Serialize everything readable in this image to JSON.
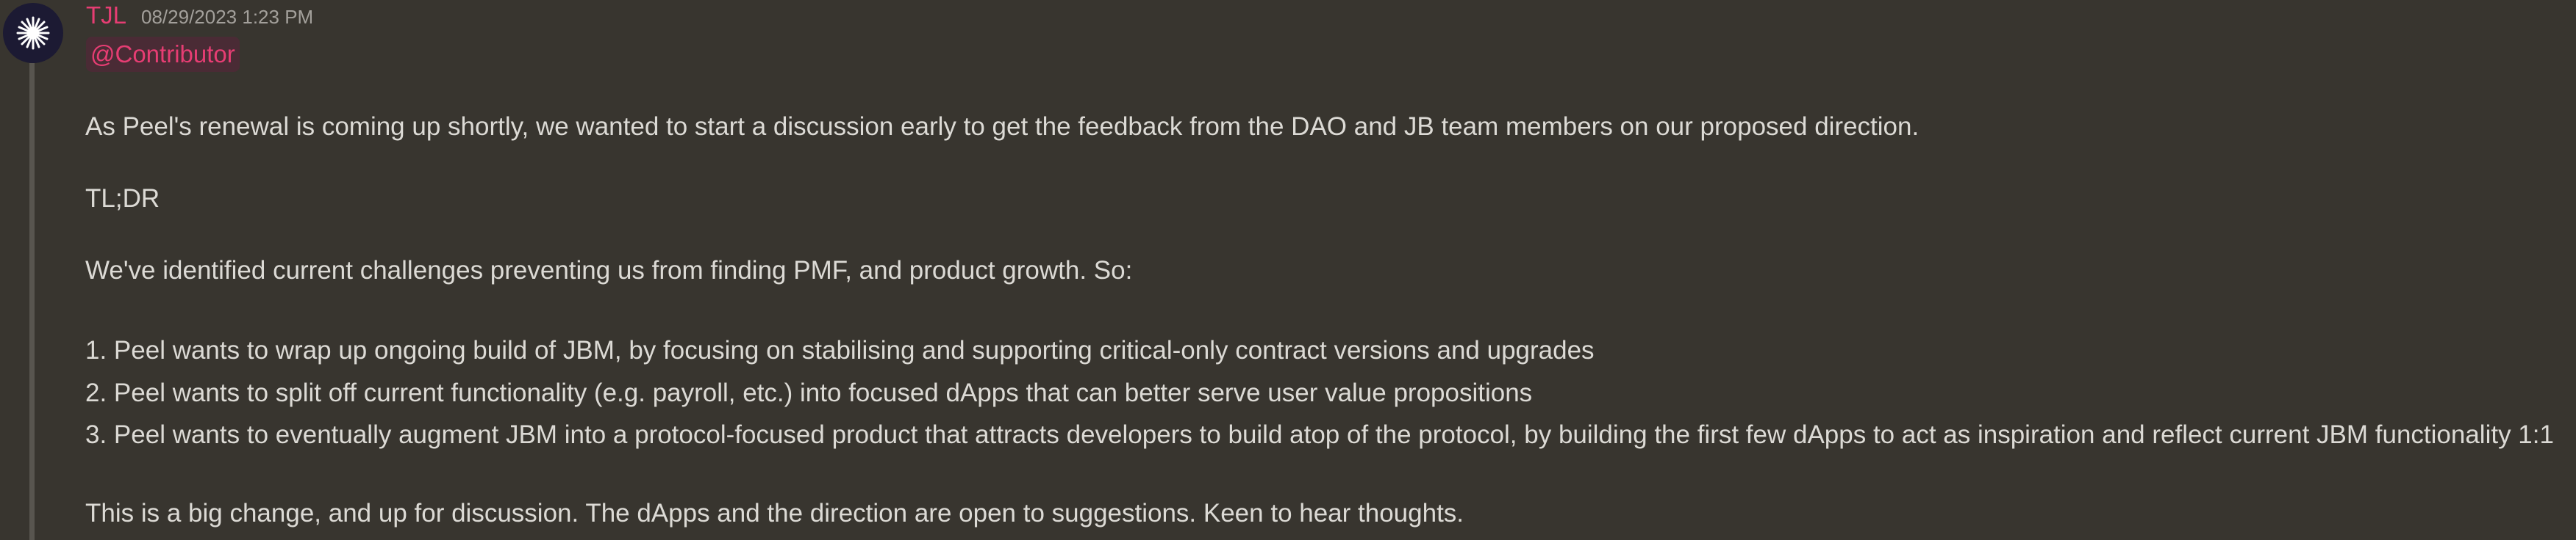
{
  "message": {
    "author": "TJL",
    "timestamp": "08/29/2023 1:23 PM",
    "avatar_icon": "white-star-burst-icon",
    "mention": "@Contributor",
    "colors": {
      "background": "#38352f",
      "author": "#e63d73",
      "mention_text": "#e63d73",
      "mention_bg": "#4a2b35",
      "text": "#dcdad5"
    },
    "lines": [
      "As Peel's renewal is coming up shortly, we wanted to start a discussion early to get the feedback from the DAO and JB team members on our proposed direction.",
      "TL;DR",
      "We've identified current challenges preventing us from finding PMF, and product growth. So:",
      "1. Peel wants to wrap up ongoing build of JBM, by focusing on stabilising and supporting critical-only contract versions and upgrades",
      "2. Peel wants to split off current functionality (e.g. payroll, etc.) into focused dApps that can better serve user value propositions",
      "3. Peel wants to eventually augment JBM into a protocol-focused product that attracts developers to build atop of the protocol, by building the first few dApps to act as inspiration and reflect current JBM functionality 1:1",
      "This is a big change, and up for discussion. The dApps and the direction are open to suggestions. Keen to hear thoughts."
    ]
  }
}
